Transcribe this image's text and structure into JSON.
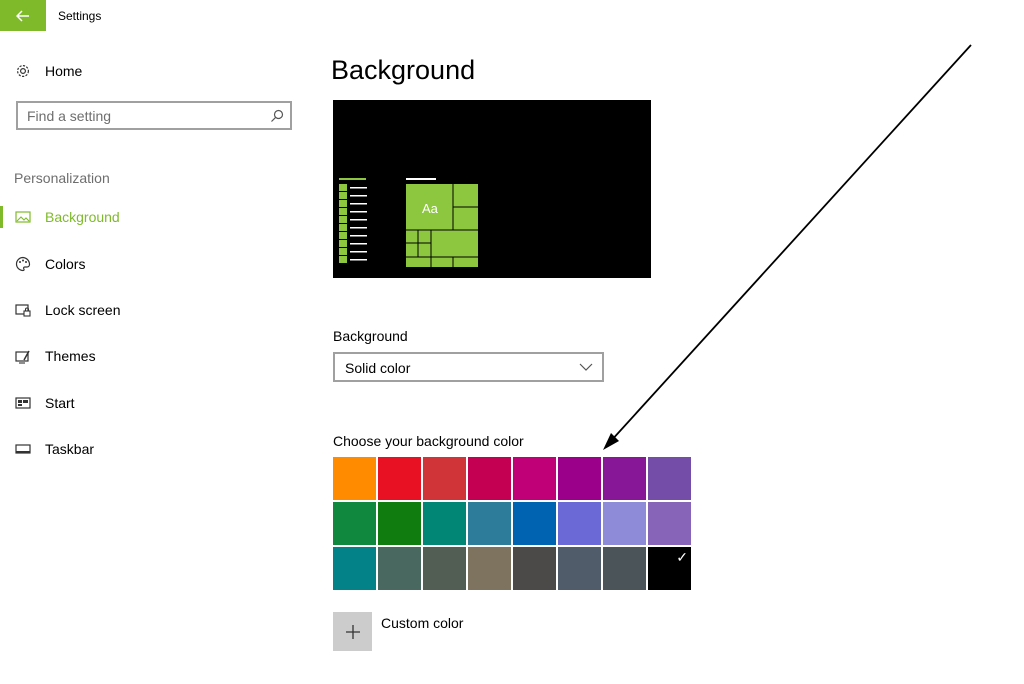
{
  "window": {
    "title": "Settings"
  },
  "sidebar": {
    "home_label": "Home",
    "search": {
      "placeholder": "Find a setting"
    },
    "section_title": "Personalization",
    "items": [
      {
        "label": "Background",
        "icon": "picture-icon",
        "active": true
      },
      {
        "label": "Colors",
        "icon": "palette-icon",
        "active": false
      },
      {
        "label": "Lock screen",
        "icon": "lock-screen-icon",
        "active": false
      },
      {
        "label": "Themes",
        "icon": "themes-icon",
        "active": false
      },
      {
        "label": "Start",
        "icon": "start-icon",
        "active": false
      },
      {
        "label": "Taskbar",
        "icon": "taskbar-icon",
        "active": false
      }
    ]
  },
  "main": {
    "title": "Background",
    "preview": {
      "tile_text": "Aa"
    },
    "background_label": "Background",
    "background_value": "Solid color",
    "colors_label": "Choose your background color",
    "swatches": [
      "#ff8c00",
      "#e81123",
      "#d13438",
      "#c30052",
      "#bf0077",
      "#9a0089",
      "#881798",
      "#744da9",
      "#10893e",
      "#107c10",
      "#018574",
      "#2d7d9a",
      "#0063b1",
      "#6b69d6",
      "#8e8cd8",
      "#8764b8",
      "#038387",
      "#486860",
      "#525e54",
      "#7e735f",
      "#4c4a48",
      "#515c6b",
      "#4a5459",
      "#000000"
    ],
    "selected_swatch": 23,
    "custom_color_label": "Custom color"
  },
  "colors": {
    "accent": "#7fba2a"
  }
}
